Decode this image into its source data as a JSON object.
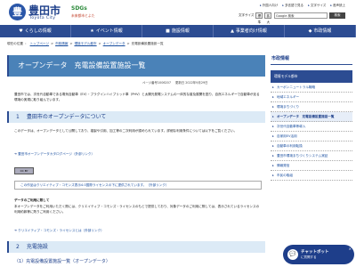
{
  "header": {
    "city_name": "豊田市",
    "city_en": "Toyota City",
    "sdgs_label": "SDGs",
    "sdgs_sub": "未来都市とよた",
    "top_links": [
      "外国人向け",
      "多言語で見る",
      "文字サイズ",
      "音声読上"
    ],
    "font_size_label": "文字サイズ",
    "font_buttons": [
      "標準",
      "拡大"
    ],
    "search_placeholder": "Google 検索",
    "search_button": "検索"
  },
  "gnav": [
    {
      "icon": "♥",
      "label": "くらしの情報"
    },
    {
      "icon": "★",
      "label": "イベント情報"
    },
    {
      "icon": "■",
      "label": "施設情報"
    },
    {
      "icon": "▲",
      "label": "事業者向け情報"
    },
    {
      "icon": "◆",
      "label": "市政情報"
    }
  ],
  "breadcrumb": [
    "現在の位置",
    "トップページ",
    "市政情報",
    "環境モデル都市",
    "オープンデータ",
    "充電設備設置施設一覧"
  ],
  "page": {
    "title": "オープンデータ　充電設備設置施設一覧",
    "page_id": "ページ番号1006207",
    "updated": "更新日 2022年9月29日",
    "intro": "豊田市では、次世代自動車である電気自動車（EV）・プラグインハイブリッド車（PHV）と太陽光発電システムの一体的な普及展開を図り、自然エネルギーで自動車が走る環境の実現に取り組んでいます。",
    "section1": {
      "num": "1",
      "title": "豊田市のオープンデータについて"
    },
    "section1_text": "このデータは、オープンデータとして公開しており、複製や引用、加工等の二次利用が認められています。詳細な利用条件については以下をご覧ください。",
    "section1_link": "豊田市オープンデータカタログページ（外部リンク）",
    "cc_badge": "CC BY",
    "note": "この作品はクリエイティブ・コモンズ表示4.0国際ライセンスの下に提供されています。（外部リンク）",
    "usage_title": "データのご利用に際して",
    "usage_text": "本オープンデータをご利用いただく際には、クリエイティブ・コモンズ・ライセンスのもとで提供しており、対象データのご利用に際しては、表示されているライセンスの利用約款等に則りご利用ください。",
    "usage_link": "クリエイティブ・コモンズ・ライセンスとは（外部リンク）",
    "section2": {
      "num": "2",
      "title": "充電施設"
    },
    "subsection": "（1）充電設備設置施設一覧（オープンデータ）"
  },
  "sidebar": {
    "title": "市政情報",
    "current": "環境モデル都市",
    "items": [
      "カーボンニュートラル戦略",
      "地域エネルギー",
      "環境まちづくり",
      "オープンデータ　充電設備設置施設一覧",
      "次世代自動車等導入",
      "自家用EV活用",
      "自動車の利用転換",
      "豊田市環境まちづくりシステム実証",
      "情報発信",
      "市民の取組"
    ]
  },
  "chatbot": {
    "label": "チャットボット",
    "sub": "に質問する",
    "close": "×"
  }
}
